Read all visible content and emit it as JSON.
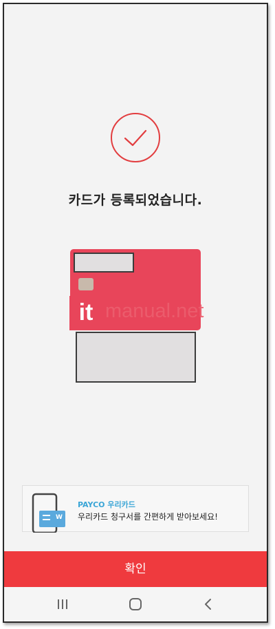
{
  "screen": {
    "headline": "카드가 등록되었습니다."
  },
  "watermark": {
    "badge": "it",
    "text": "manual.net"
  },
  "promo": {
    "title": "PAYCO 우리카드",
    "description": "우리카드 청구서를 간편하게 받아보세요!",
    "icon": "bill-card-icon"
  },
  "confirm_button": {
    "label": "확인"
  },
  "nav": {
    "recent_icon": "recent-apps-icon",
    "home_icon": "home-icon",
    "back_icon": "back-icon"
  },
  "colors": {
    "accent": "#ef3a3e",
    "card": "#e8455a",
    "promo_title": "#3aa5d6"
  }
}
